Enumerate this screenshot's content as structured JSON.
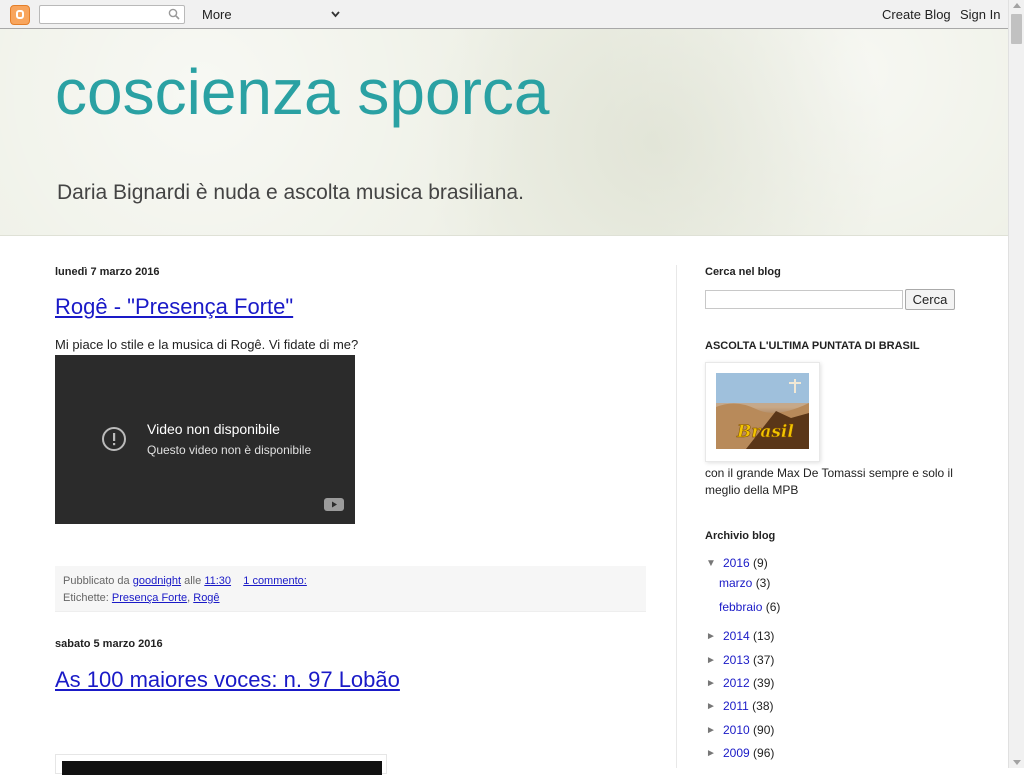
{
  "navbar": {
    "more_label": "More",
    "create_blog": "Create Blog",
    "sign_in": "Sign In"
  },
  "header": {
    "title": "coscienza sporca",
    "description": "Daria Bignardi è nuda e ascolta musica brasiliana."
  },
  "posts": [
    {
      "date": "lunedì 7 marzo 2016",
      "title": "Rogê - \"Presença Forte\"",
      "body": "Mi piace lo stile e la musica di Rogê. Vi fidate di me?",
      "video_title": "Video non disponibile",
      "video_sub": "Questo video non è disponibile",
      "footer": {
        "published_by": "Pubblicato da",
        "author": "goodnight",
        "at": "alle",
        "time": "11:30",
        "comments": "1 commento:",
        "labels_prefix": "Etichette:",
        "labels": [
          "Presença Forte",
          "Rogê"
        ]
      }
    },
    {
      "date": "sabato 5 marzo 2016",
      "title": "As 100 maiores voces: n. 97 Lobão"
    }
  ],
  "sidebar": {
    "search_heading": "Cerca nel blog",
    "search_button": "Cerca",
    "brasil_heading": "ASCOLTA L'ULTIMA PUNTATA DI BRASIL",
    "brasil_image_text": "Brasil",
    "brasil_text": "con il grande Max De Tomassi sempre e solo il meglio della MPB",
    "archive_heading": "Archivio blog",
    "archive": [
      {
        "year": "2016",
        "count": "(9)",
        "expanded": true,
        "months": [
          {
            "name": "marzo",
            "count": "(3)"
          },
          {
            "name": "febbraio",
            "count": "(6)"
          }
        ]
      },
      {
        "year": "2014",
        "count": "(13)"
      },
      {
        "year": "2013",
        "count": "(37)"
      },
      {
        "year": "2012",
        "count": "(39)"
      },
      {
        "year": "2011",
        "count": "(38)"
      },
      {
        "year": "2010",
        "count": "(90)"
      },
      {
        "year": "2009",
        "count": "(96)"
      }
    ]
  }
}
